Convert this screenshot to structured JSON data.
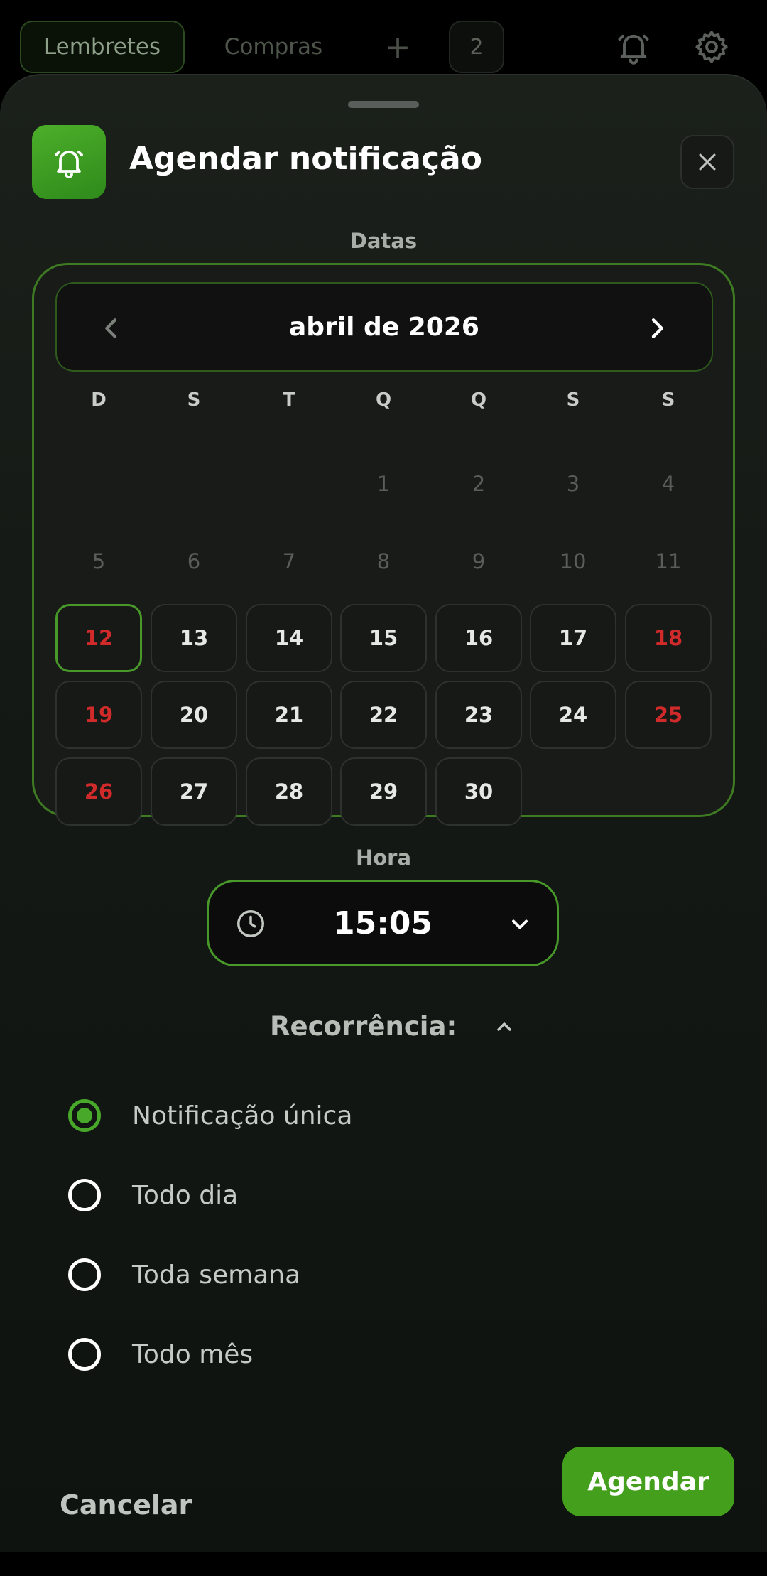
{
  "tabs": [
    {
      "label": "Lembretes",
      "active": true
    },
    {
      "label": "Compras",
      "active": false
    }
  ],
  "tab_add_label": "+",
  "tab_count": "2",
  "icons": {
    "bell": "bell-icon",
    "gear": "gear-icon",
    "close": "close-icon",
    "clock": "clock-icon"
  },
  "dialog": {
    "title": "Agendar notificação",
    "dates_label": "Datas",
    "hour_label": "Hora"
  },
  "calendar": {
    "month_label": "abril de 2026",
    "weekdays": [
      "D",
      "S",
      "T",
      "Q",
      "Q",
      "S",
      "S"
    ],
    "leading_blanks": 3,
    "days": [
      "1",
      "2",
      "3",
      "4",
      "5",
      "6",
      "7",
      "8",
      "9",
      "10",
      "11",
      "12",
      "13",
      "14",
      "15",
      "16",
      "17",
      "18",
      "19",
      "20",
      "21",
      "22",
      "23",
      "24",
      "25",
      "26",
      "27",
      "28",
      "29",
      "30"
    ],
    "first_selectable_day": 12,
    "today": 12
  },
  "time": {
    "value": "15:05"
  },
  "recurrence": {
    "label": "Recorrência:",
    "options": [
      {
        "label": "Notificação única",
        "checked": true
      },
      {
        "label": "Todo dia",
        "checked": false
      },
      {
        "label": "Toda semana",
        "checked": false
      },
      {
        "label": "Todo mês",
        "checked": false
      }
    ]
  },
  "actions": {
    "cancel": "Cancelar",
    "confirm": "Agendar"
  },
  "colors": {
    "accent": "#48992a",
    "weekend": "#d02a2a",
    "background": "#000000"
  }
}
